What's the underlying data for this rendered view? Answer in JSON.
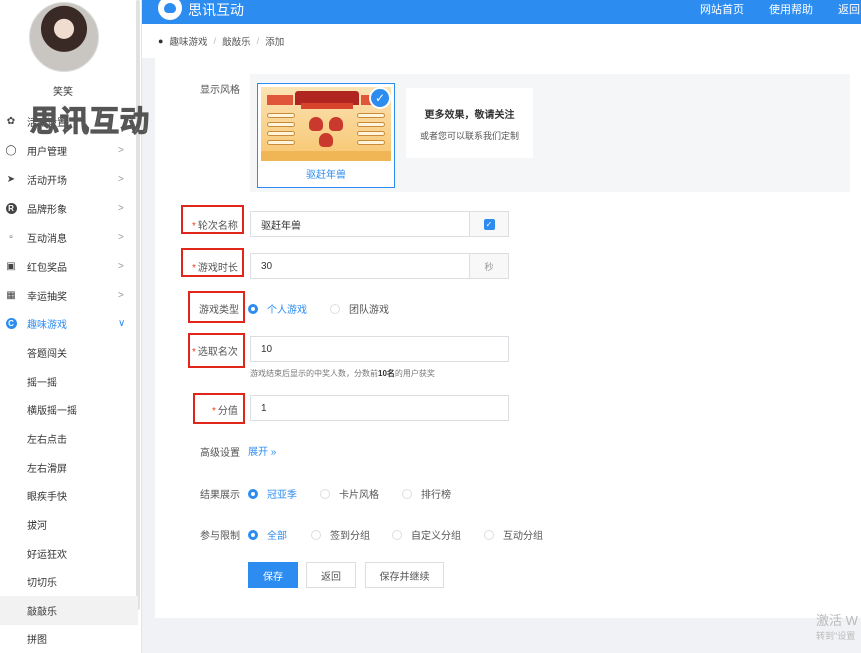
{
  "app": {
    "title": "思讯互动",
    "watermark": "思讯互动",
    "brand_color": "#2d8cf0",
    "nav": [
      "网站首页",
      "使用帮助",
      "返回"
    ]
  },
  "user": {
    "name": "笑笑"
  },
  "sidebar": {
    "items": [
      {
        "label": "活动设置",
        "icon": "gear-icon"
      },
      {
        "label": "用户管理",
        "icon": "user-icon"
      },
      {
        "label": "活动开场",
        "icon": "send-icon"
      },
      {
        "label": "品牌形象",
        "icon": "brand-icon"
      },
      {
        "label": "互动消息",
        "icon": "message-icon"
      },
      {
        "label": "红包奖品",
        "icon": "redpacket-icon"
      },
      {
        "label": "幸运抽奖",
        "icon": "lottery-icon"
      },
      {
        "label": "趣味游戏",
        "icon": "game-icon",
        "active": true
      }
    ],
    "sub_items": [
      "答题闯关",
      "摇一摇",
      "横版摇一摇",
      "左右点击",
      "左右滑屏",
      "眼疾手快",
      "拔河",
      "好运狂欢",
      "切切乐",
      "敲敲乐",
      "拼图"
    ],
    "selected_sub": "敲敲乐"
  },
  "breadcrumb": [
    "趣味游戏",
    "敲敲乐",
    "添加"
  ],
  "form": {
    "style": {
      "label": "显示风格",
      "selected_name": "驱赶年兽",
      "more_title": "更多效果，敬请关注",
      "more_sub": "或者您可以联系我们定制"
    },
    "round_name": {
      "label": "轮次名称",
      "value": "驱赶年兽",
      "checked": true
    },
    "duration": {
      "label": "游戏时长",
      "value": "30",
      "unit": "秒"
    },
    "game_type": {
      "label": "游戏类型",
      "options": [
        "个人游戏",
        "团队游戏"
      ],
      "selected": "个人游戏"
    },
    "pick_rank": {
      "label": "选取名次",
      "value": "10",
      "hint_pre": "游戏结束后显示的中奖人数，分数前",
      "hint_bold": "10名",
      "hint_post": "的用户获奖"
    },
    "score": {
      "label": "分值",
      "value": "1"
    },
    "advanced": {
      "label": "高级设置",
      "link": "展开 »"
    },
    "result": {
      "label": "结果展示",
      "options": [
        "冠亚季",
        "卡片风格",
        "排行榜"
      ],
      "selected": "冠亚季"
    },
    "participation": {
      "label": "参与限制",
      "options": [
        "全部",
        "签到分组",
        "自定义分组",
        "互动分组"
      ],
      "selected": "全部"
    }
  },
  "buttons": {
    "save": "保存",
    "back": "返回",
    "save_continue": "保存并继续"
  },
  "system": {
    "activate_line1": "激活 W",
    "activate_line2": "转到\"设置"
  }
}
